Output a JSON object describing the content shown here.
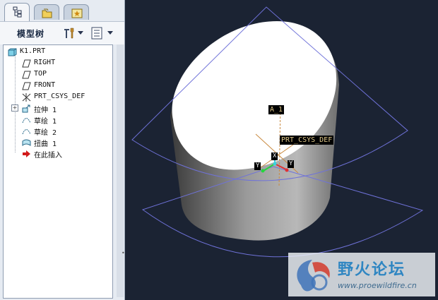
{
  "panel": {
    "tabs": [
      {
        "name": "model-tree-tab",
        "icon": "model-tree-icon",
        "active": true
      },
      {
        "name": "folder-browser-tab",
        "icon": "folder-icon",
        "active": false
      },
      {
        "name": "favorites-tab",
        "icon": "favorites-icon",
        "active": false
      }
    ],
    "title": "模型树",
    "settings_icon": "settings-tools-icon",
    "show_icon": "show-list-icon"
  },
  "tree": {
    "root": {
      "label": "K1.PRT",
      "icon": "part-icon"
    },
    "items": [
      {
        "label": "RIGHT",
        "icon": "datum-plane-icon"
      },
      {
        "label": "TOP",
        "icon": "datum-plane-icon"
      },
      {
        "label": "FRONT",
        "icon": "datum-plane-icon"
      },
      {
        "label": "PRT_CSYS_DEF",
        "icon": "coordinate-system-icon"
      },
      {
        "label": "拉伸 1",
        "icon": "extrude-icon"
      },
      {
        "label": "草绘 1",
        "icon": "sketch-icon"
      },
      {
        "label": "草绘 2",
        "icon": "sketch-icon"
      },
      {
        "label": "扭曲 1",
        "icon": "warp-icon"
      },
      {
        "label": "在此插入",
        "icon": "insert-here-arrow-icon"
      }
    ]
  },
  "viewport": {
    "background": "#1b2333",
    "axis_label": "A_1",
    "csys_label": "PRT_CSYS_DEF",
    "axis_x": "Y",
    "axis_y": "X",
    "axis_z": "Y"
  },
  "watermark": {
    "title": "野火论坛",
    "url": "www.proewildfire.cn"
  }
}
